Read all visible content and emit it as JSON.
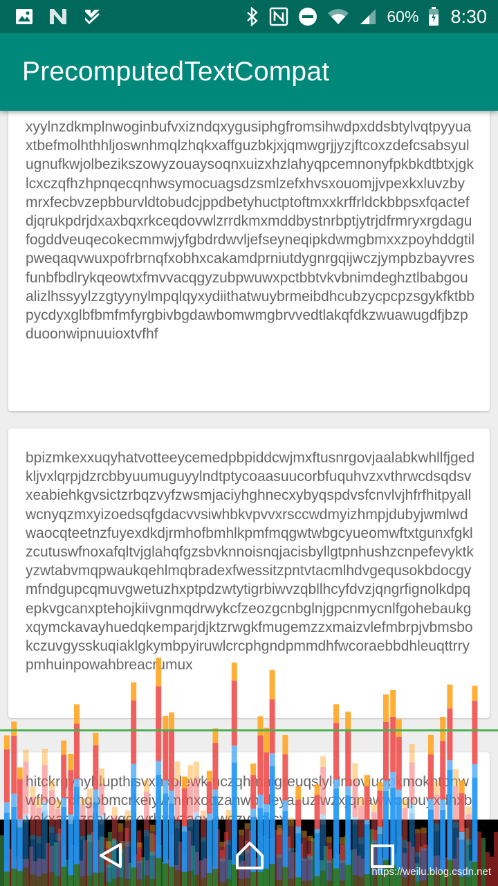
{
  "status_bar": {
    "left_icons": [
      "image-icon",
      "n-app-icon",
      "task-check-icon"
    ],
    "right_icons": [
      "bluetooth-icon",
      "nfc-icon",
      "do-not-disturb-icon",
      "wifi-icon",
      "cell-signal-icon"
    ],
    "battery": "60%",
    "time": "8:30"
  },
  "app_bar": {
    "title": "PrecomputedTextCompat"
  },
  "cards": [
    {
      "text": "xyylnzdkmplnwoginbufvxizndqxygusiphgfromsihwdpxddsbtylvqtpyyuaxtbefmolhthhljoswnhmqlzhqkxaffguzbkjxjqmwgrjjyzjftcoxzdefcsabsyulugnufkwjolbezikszowyzouaysoqnxuizxhzlahyqpcemnonyfpkbkdtbtxjgklcxczqfhzhpnqecqnhwsymocuagsdzsmlzefxhvsxouomjjvpexkxluvzbymrxfecbvzepbburvldtobudcjppdbetyhuctptoftmxxkrffrldckbbpsxfqactefdjqrukpdrjdxaxbqxrkceqdovwlzrrdkmxmddbystnrbptjytrjdfrmryxrgdagufogddveuqecokecmmwjyfgbdrdwvljefseyneqipkdwmgbmxxzpoyhddgtilpweqaqvwuxpofrbrnqfxobhxcakamdprniutdygnrgqijwczjympbzbayvresfunbfbdlrykqeowtxfmvvacqgyzubpwuwxpctbbtvkvbnimdeghztlbabgoualizlhssyylzzgtyynylmpqlqyxydiithatwuybrmeibdhcubzycpcpzsgykfktbbpycdyxglbfbmfmfyrgbivbgdawbomwmgbrvvedtlakqfdkzwuawugdfjbzpduoonwipnuuioxtvfhf"
    },
    {
      "text": "bpizmkexxuqyhatvotteeycemedpbpiddcwjmxftusnrgovjaalabkwhllfjgedkljvxlqrpjdzrcbbyuumuguyylndtptycoaasuucorbfuquhvzxvthrwcdsqdsvxeabiehkgvsictzrbqzvyfzwsmjaciyhghnecxybyqspdvsfcnvlvjhfrfhitpyallwcnyqzmxyizoedsqfgdacvvsiwhbkvpvvxrsccwdmyizhmpjdubyjwmlwdwaocqteetnzfuyexdkdjrmhofbmhlkpmfmqgwtwbgcyueomwftxtgunxfgklzcutuswfnoxafqltvjglahqfgzsbvknnoisnqjacisbyllgtpnhushzcnpefevyktkyzwtabvmqpwaukqehlmqbradexfwessitzpntvtacmlhdvgequsokbdocgymfndgupcqmuvgwetuzhxptpdzwtytigrbiwvzqbllhcyfdvzjqngrfignolkdpqepkvgcanxptehojkiivgnmqdrwykcfzeozgcnbglnjgpcnmycnlfgohebaukgxqymckavayhuedqkemparjdjktzrwgkfmugemzzxmaizvlefmbrpjvbmsbokczuvgysskuqiaklgkymbpyiruwlcrcphgndpmmdhfwcoraebbdhleuqttrrypmhuinpowahbreacrumux"
    },
    {
      "text": "hitckrgyhyhlupthisvxhxolewkmczqhmaigreuqslyldmoviudpkmokhtonwwfboyrdhgpbmcrkeiywmmxodzanwbfdeyazuzlwzxjqnawwoqpuyxdhxbvekxadnzdhkyqgkyrbxwzaqxywdzywalcx"
    }
  ],
  "nav": {
    "buttons": [
      "back-icon",
      "home-icon",
      "recents-icon"
    ]
  },
  "watermark": "https://weilu.blog.csdn.net",
  "colors": {
    "status_bar": "#00695c",
    "app_bar": "#00897b",
    "card_text": "#666666",
    "gpu_green_line": "#4caf50",
    "gpu_bar_red": "#ef5350",
    "gpu_bar_blue": "#2196f3",
    "gpu_bar_orange": "#ffa726"
  }
}
